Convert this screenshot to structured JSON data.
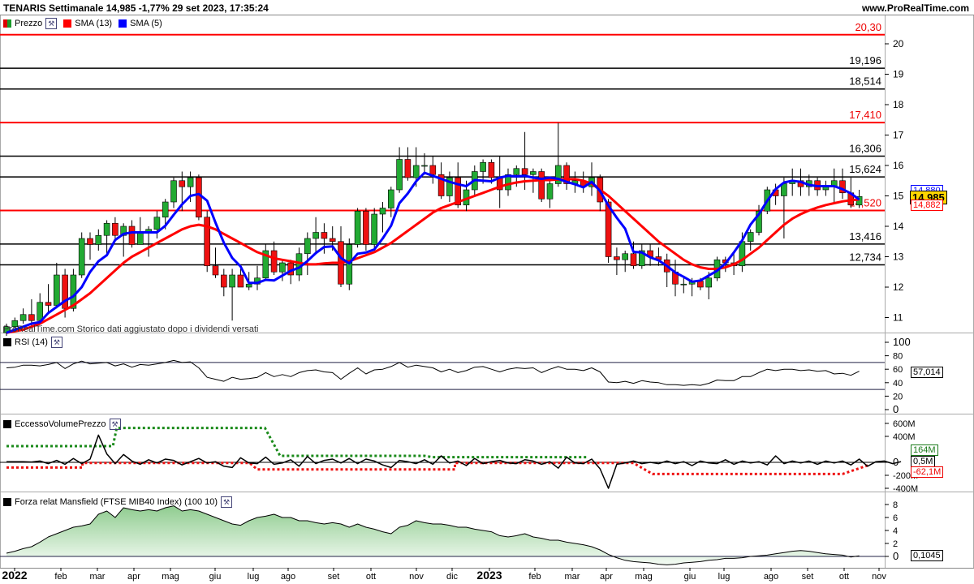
{
  "header": {
    "title": "TENARIS Settimanale 14,985 -1,77% 29 set 2023, 17:35:24",
    "site": "www.ProRealTime.com"
  },
  "price_panel": {
    "legend": [
      {
        "label": "Prezzo",
        "color": "#1a9a2a"
      },
      {
        "label": "SMA (13)",
        "color": "#ff0000"
      },
      {
        "label": "SMA (5)",
        "color": "#0000ff"
      }
    ],
    "watermark": "ProRealTime.com Storico dati aggiustato dopo i dividendi versati",
    "last_price": "14,985",
    "sma5_last": "14,880",
    "sma13_last": "14,882",
    "y_ticks": [
      "20",
      "19",
      "18",
      "17",
      "16",
      "15",
      "14",
      "13",
      "12",
      "11"
    ],
    "levels": [
      {
        "value": 20.3,
        "label": "20,30",
        "color": "#ff0000"
      },
      {
        "value": 19.196,
        "label": "19,196",
        "color": "#000000"
      },
      {
        "value": 18.514,
        "label": "18,514",
        "color": "#000000"
      },
      {
        "value": 17.41,
        "label": "17,410",
        "color": "#ff0000"
      },
      {
        "value": 16.306,
        "label": "16,306",
        "color": "#000000"
      },
      {
        "value": 15.624,
        "label": "15,624",
        "color": "#000000"
      },
      {
        "value": 14.52,
        "label": "14,520",
        "color": "#ff0000"
      },
      {
        "value": 13.416,
        "label": "13,416",
        "color": "#000000"
      },
      {
        "value": 12.734,
        "label": "12,734",
        "color": "#000000"
      }
    ]
  },
  "rsi_panel": {
    "title": "RSI (14)",
    "y_ticks": [
      "100",
      "80",
      "60",
      "40",
      "20",
      "0"
    ],
    "last": "57,014"
  },
  "volume_panel": {
    "title": "EccessoVolumePrezzo",
    "y_ticks": [
      "600M",
      "400M",
      "0",
      "-200M",
      "-400M"
    ],
    "upper_label": "164M",
    "mid_label": "0,5M",
    "lower_label": "-62,1M"
  },
  "mansfield_panel": {
    "title": "Forza relat Mansfield (FTSE MIB40 Index) (100 10)",
    "y_ticks": [
      "8",
      "6",
      "4",
      "2",
      "0"
    ],
    "last": "0,1045"
  },
  "x_axis": {
    "labels": [
      "2022",
      "feb",
      "mar",
      "apr",
      "mag",
      "giu",
      "lug",
      "ago",
      "set",
      "ott",
      "nov",
      "dic",
      "2023",
      "feb",
      "mar",
      "apr",
      "mag",
      "giu",
      "lug",
      "ago",
      "set",
      "ott",
      "nov"
    ]
  },
  "colors": {
    "up": "#22aa33",
    "down": "#ee1111",
    "sma13": "#ff0000",
    "sma5": "#0000ff",
    "volume_upper": "#1a8a1a",
    "volume_lower": "#ee1111",
    "mansfield_pos": "#b8dcb8",
    "mansfield_neg": "#e8b8c8"
  },
  "chart_data": {
    "type": "candlestick",
    "title": "TENARIS Settimanale",
    "ylim": [
      10.5,
      20.8
    ],
    "candles": [
      {
        "o": 10.5,
        "h": 10.8,
        "l": 10.4,
        "c": 10.7
      },
      {
        "o": 10.7,
        "h": 11.0,
        "l": 10.6,
        "c": 10.9
      },
      {
        "o": 10.9,
        "h": 11.3,
        "l": 10.8,
        "c": 11.1
      },
      {
        "o": 11.1,
        "h": 11.6,
        "l": 10.7,
        "c": 10.9
      },
      {
        "o": 10.9,
        "h": 11.8,
        "l": 10.8,
        "c": 11.5
      },
      {
        "o": 11.5,
        "h": 12.1,
        "l": 11.2,
        "c": 11.4
      },
      {
        "o": 11.4,
        "h": 12.8,
        "l": 11.3,
        "c": 12.4
      },
      {
        "o": 12.4,
        "h": 12.6,
        "l": 11.0,
        "c": 11.3
      },
      {
        "o": 11.3,
        "h": 12.6,
        "l": 11.2,
        "c": 12.4
      },
      {
        "o": 12.4,
        "h": 13.8,
        "l": 12.3,
        "c": 13.6
      },
      {
        "o": 13.6,
        "h": 13.8,
        "l": 12.9,
        "c": 13.4
      },
      {
        "o": 13.4,
        "h": 13.9,
        "l": 13.2,
        "c": 13.7
      },
      {
        "o": 13.7,
        "h": 14.2,
        "l": 13.1,
        "c": 14.1
      },
      {
        "o": 14.1,
        "h": 14.3,
        "l": 13.5,
        "c": 13.7
      },
      {
        "o": 13.7,
        "h": 14.1,
        "l": 13.0,
        "c": 14.0
      },
      {
        "o": 14.0,
        "h": 14.2,
        "l": 13.3,
        "c": 13.4
      },
      {
        "o": 13.4,
        "h": 14.3,
        "l": 13.4,
        "c": 13.8
      },
      {
        "o": 13.8,
        "h": 14.0,
        "l": 13.0,
        "c": 13.9
      },
      {
        "o": 13.9,
        "h": 14.5,
        "l": 13.6,
        "c": 14.3
      },
      {
        "o": 14.3,
        "h": 14.9,
        "l": 13.9,
        "c": 14.8
      },
      {
        "o": 14.8,
        "h": 15.6,
        "l": 14.6,
        "c": 15.5
      },
      {
        "o": 15.5,
        "h": 15.8,
        "l": 14.5,
        "c": 15.3
      },
      {
        "o": 15.3,
        "h": 15.8,
        "l": 14.8,
        "c": 15.6
      },
      {
        "o": 15.6,
        "h": 15.7,
        "l": 14.2,
        "c": 14.3
      },
      {
        "o": 14.3,
        "h": 14.5,
        "l": 12.5,
        "c": 12.7
      },
      {
        "o": 12.7,
        "h": 13.3,
        "l": 12.3,
        "c": 12.4
      },
      {
        "o": 12.4,
        "h": 12.6,
        "l": 11.7,
        "c": 12.0
      },
      {
        "o": 12.0,
        "h": 12.6,
        "l": 10.9,
        "c": 12.4
      },
      {
        "o": 12.4,
        "h": 12.6,
        "l": 12.0,
        "c": 12.0
      },
      {
        "o": 12.0,
        "h": 12.5,
        "l": 11.9,
        "c": 12.1
      },
      {
        "o": 12.1,
        "h": 12.7,
        "l": 11.9,
        "c": 12.3
      },
      {
        "o": 12.3,
        "h": 13.4,
        "l": 12.2,
        "c": 13.2
      },
      {
        "o": 13.2,
        "h": 13.5,
        "l": 12.4,
        "c": 12.5
      },
      {
        "o": 12.5,
        "h": 12.9,
        "l": 12.2,
        "c": 12.8
      },
      {
        "o": 12.8,
        "h": 12.9,
        "l": 12.1,
        "c": 12.4
      },
      {
        "o": 12.4,
        "h": 13.3,
        "l": 12.2,
        "c": 13.1
      },
      {
        "o": 13.1,
        "h": 13.8,
        "l": 12.4,
        "c": 13.6
      },
      {
        "o": 13.6,
        "h": 14.3,
        "l": 13.1,
        "c": 13.8
      },
      {
        "o": 13.8,
        "h": 14.1,
        "l": 13.1,
        "c": 13.6
      },
      {
        "o": 13.6,
        "h": 14.0,
        "l": 13.2,
        "c": 13.5
      },
      {
        "o": 13.5,
        "h": 14.0,
        "l": 12.0,
        "c": 12.1
      },
      {
        "o": 12.1,
        "h": 13.6,
        "l": 11.9,
        "c": 13.4
      },
      {
        "o": 13.4,
        "h": 14.6,
        "l": 13.3,
        "c": 14.5
      },
      {
        "o": 14.5,
        "h": 14.6,
        "l": 13.2,
        "c": 13.4
      },
      {
        "o": 13.4,
        "h": 14.6,
        "l": 13.2,
        "c": 14.4
      },
      {
        "o": 14.4,
        "h": 14.8,
        "l": 13.8,
        "c": 14.6
      },
      {
        "o": 14.6,
        "h": 15.3,
        "l": 14.3,
        "c": 15.2
      },
      {
        "o": 15.2,
        "h": 16.6,
        "l": 15.1,
        "c": 16.2
      },
      {
        "o": 16.2,
        "h": 16.6,
        "l": 15.5,
        "c": 15.6
      },
      {
        "o": 15.6,
        "h": 16.6,
        "l": 15.3,
        "c": 16.0
      },
      {
        "o": 16.0,
        "h": 16.4,
        "l": 15.7,
        "c": 16.0
      },
      {
        "o": 16.0,
        "h": 16.3,
        "l": 15.4,
        "c": 15.7
      },
      {
        "o": 15.7,
        "h": 16.1,
        "l": 14.9,
        "c": 15.0
      },
      {
        "o": 15.0,
        "h": 15.8,
        "l": 14.8,
        "c": 15.6
      },
      {
        "o": 15.6,
        "h": 16.1,
        "l": 14.6,
        "c": 14.7
      },
      {
        "o": 14.7,
        "h": 15.5,
        "l": 14.5,
        "c": 15.2
      },
      {
        "o": 15.2,
        "h": 16.0,
        "l": 15.0,
        "c": 15.8
      },
      {
        "o": 15.8,
        "h": 16.2,
        "l": 15.4,
        "c": 16.1
      },
      {
        "o": 16.1,
        "h": 16.2,
        "l": 15.4,
        "c": 15.6
      },
      {
        "o": 15.6,
        "h": 16.3,
        "l": 14.6,
        "c": 15.2
      },
      {
        "o": 15.2,
        "h": 15.9,
        "l": 15.0,
        "c": 15.7
      },
      {
        "o": 15.7,
        "h": 16.0,
        "l": 15.3,
        "c": 15.9
      },
      {
        "o": 15.9,
        "h": 17.1,
        "l": 15.2,
        "c": 15.7
      },
      {
        "o": 15.7,
        "h": 15.9,
        "l": 15.1,
        "c": 15.8
      },
      {
        "o": 15.8,
        "h": 15.9,
        "l": 14.8,
        "c": 14.9
      },
      {
        "o": 14.9,
        "h": 15.6,
        "l": 14.6,
        "c": 15.4
      },
      {
        "o": 15.4,
        "h": 17.4,
        "l": 15.3,
        "c": 16.0
      },
      {
        "o": 16.0,
        "h": 16.1,
        "l": 15.2,
        "c": 15.4
      },
      {
        "o": 15.4,
        "h": 15.8,
        "l": 15.1,
        "c": 15.5
      },
      {
        "o": 15.5,
        "h": 15.8,
        "l": 15.1,
        "c": 15.3
      },
      {
        "o": 15.3,
        "h": 16.1,
        "l": 15.0,
        "c": 15.6
      },
      {
        "o": 15.6,
        "h": 15.7,
        "l": 14.5,
        "c": 14.8
      },
      {
        "o": 14.8,
        "h": 14.9,
        "l": 12.8,
        "c": 13.0
      },
      {
        "o": 13.0,
        "h": 13.3,
        "l": 12.4,
        "c": 12.9
      },
      {
        "o": 12.9,
        "h": 13.2,
        "l": 12.5,
        "c": 13.1
      },
      {
        "o": 13.1,
        "h": 13.5,
        "l": 12.6,
        "c": 12.7
      },
      {
        "o": 12.7,
        "h": 13.4,
        "l": 12.6,
        "c": 13.2
      },
      {
        "o": 13.2,
        "h": 13.4,
        "l": 12.7,
        "c": 13.0
      },
      {
        "o": 13.0,
        "h": 13.3,
        "l": 12.7,
        "c": 12.9
      },
      {
        "o": 12.9,
        "h": 13.1,
        "l": 12.0,
        "c": 12.5
      },
      {
        "o": 12.5,
        "h": 12.9,
        "l": 11.7,
        "c": 12.1
      },
      {
        "o": 12.1,
        "h": 12.3,
        "l": 11.8,
        "c": 12.1
      },
      {
        "o": 12.1,
        "h": 12.3,
        "l": 11.7,
        "c": 12.2
      },
      {
        "o": 12.2,
        "h": 12.3,
        "l": 11.9,
        "c": 12.0
      },
      {
        "o": 12.0,
        "h": 12.5,
        "l": 11.6,
        "c": 12.3
      },
      {
        "o": 12.3,
        "h": 13.0,
        "l": 12.2,
        "c": 12.9
      },
      {
        "o": 12.9,
        "h": 13.0,
        "l": 12.5,
        "c": 12.8
      },
      {
        "o": 12.8,
        "h": 13.1,
        "l": 12.4,
        "c": 12.7
      },
      {
        "o": 12.7,
        "h": 13.8,
        "l": 12.5,
        "c": 13.5
      },
      {
        "o": 13.5,
        "h": 13.9,
        "l": 13.2,
        "c": 13.8
      },
      {
        "o": 13.8,
        "h": 14.7,
        "l": 13.7,
        "c": 14.5
      },
      {
        "o": 14.5,
        "h": 15.3,
        "l": 14.4,
        "c": 15.2
      },
      {
        "o": 15.2,
        "h": 15.4,
        "l": 14.7,
        "c": 15.0
      },
      {
        "o": 15.0,
        "h": 15.6,
        "l": 13.6,
        "c": 15.4
      },
      {
        "o": 15.4,
        "h": 15.9,
        "l": 15.0,
        "c": 15.5
      },
      {
        "o": 15.5,
        "h": 15.9,
        "l": 15.0,
        "c": 15.3
      },
      {
        "o": 15.3,
        "h": 15.7,
        "l": 15.0,
        "c": 15.5
      },
      {
        "o": 15.5,
        "h": 15.6,
        "l": 15.0,
        "c": 15.2
      },
      {
        "o": 15.2,
        "h": 15.5,
        "l": 15.0,
        "c": 15.3
      },
      {
        "o": 15.3,
        "h": 15.9,
        "l": 14.8,
        "c": 15.5
      },
      {
        "o": 15.5,
        "h": 15.9,
        "l": 14.9,
        "c": 15.1
      },
      {
        "o": 15.1,
        "h": 15.6,
        "l": 14.6,
        "c": 14.7
      },
      {
        "o": 14.7,
        "h": 15.2,
        "l": 14.6,
        "c": 14.98
      }
    ],
    "sma5": [
      10.5,
      10.6,
      10.7,
      10.8,
      10.85,
      11.15,
      11.35,
      11.55,
      11.7,
      12.0,
      12.5,
      12.85,
      13.05,
      13.55,
      13.75,
      13.8,
      13.8,
      13.8,
      13.8,
      14.02,
      14.38,
      14.72,
      15.0,
      15.06,
      14.84,
      14.12,
      13.46,
      12.96,
      12.68,
      12.14,
      12.14,
      12.24,
      12.22,
      12.38,
      12.54,
      12.64,
      12.86,
      13.12,
      13.32,
      13.34,
      12.96,
      12.78,
      13.1,
      13.14,
      13.24,
      13.6,
      14.02,
      14.76,
      15.08,
      15.48,
      15.76,
      15.66,
      15.56,
      15.46,
      15.38,
      15.32,
      15.52,
      15.5,
      15.48,
      15.6,
      15.66,
      15.64,
      15.66,
      15.6,
      15.56,
      15.6,
      15.56,
      15.46,
      15.38,
      15.28,
      15.46,
      15.16,
      14.68,
      14.28,
      13.92,
      13.16,
      13.14,
      12.98,
      12.88,
      12.7,
      12.48,
      12.34,
      12.18,
      12.22,
      12.38,
      12.54,
      12.78,
      13.14,
      13.54,
      14.06,
      14.4,
      14.84,
      15.22,
      15.44,
      15.5,
      15.46,
      15.36,
      15.32,
      15.32,
      15.32,
      15.22,
      15.08,
      14.88
    ],
    "sma13": [
      10.5,
      10.55,
      10.6,
      10.7,
      10.8,
      10.95,
      11.1,
      11.25,
      11.4,
      11.6,
      11.8,
      12.05,
      12.3,
      12.55,
      12.8,
      13.0,
      13.15,
      13.3,
      13.45,
      13.6,
      13.75,
      13.9,
      14.0,
      14.05,
      14.0,
      13.9,
      13.75,
      13.6,
      13.45,
      13.3,
      13.15,
      13.05,
      12.95,
      12.9,
      12.85,
      12.8,
      12.75,
      12.75,
      12.78,
      12.8,
      12.8,
      12.85,
      12.95,
      13.05,
      13.15,
      13.3,
      13.45,
      13.65,
      13.85,
      14.05,
      14.25,
      14.45,
      14.6,
      14.7,
      14.8,
      14.9,
      15.0,
      15.1,
      15.2,
      15.3,
      15.38,
      15.44,
      15.48,
      15.5,
      15.52,
      15.52,
      15.54,
      15.55,
      15.55,
      15.5,
      15.4,
      15.2,
      15.0,
      14.75,
      14.5,
      14.25,
      14.0,
      13.75,
      13.5,
      13.3,
      13.1,
      12.9,
      12.75,
      12.65,
      12.6,
      12.6,
      12.65,
      12.75,
      12.9,
      13.1,
      13.3,
      13.55,
      13.8,
      14.05,
      14.25,
      14.4,
      14.52,
      14.62,
      14.7,
      14.76,
      14.82,
      14.86,
      14.88
    ],
    "rsi": [
      62,
      63,
      66,
      66,
      65,
      67,
      70,
      61,
      68,
      72,
      68,
      69,
      70,
      65,
      68,
      63,
      67,
      66,
      68,
      70,
      73,
      70,
      71,
      62,
      48,
      45,
      42,
      48,
      45,
      46,
      48,
      55,
      49,
      52,
      49,
      55,
      58,
      59,
      56,
      55,
      45,
      54,
      62,
      53,
      59,
      60,
      64,
      70,
      63,
      66,
      64,
      62,
      56,
      60,
      55,
      58,
      63,
      64,
      60,
      56,
      60,
      62,
      61,
      62,
      55,
      60,
      64,
      60,
      60,
      58,
      62,
      56,
      41,
      40,
      42,
      39,
      43,
      41,
      40,
      37,
      37,
      36,
      37,
      36,
      39,
      44,
      43,
      43,
      49,
      49,
      55,
      60,
      58,
      60,
      60,
      58,
      59,
      57,
      58,
      53,
      54,
      51,
      57
    ],
    "volume_excess": [
      10,
      10,
      10,
      5,
      20,
      -20,
      30,
      -30,
      60,
      -20,
      50,
      420,
      130,
      -20,
      120,
      20,
      -30,
      40,
      -10,
      50,
      30,
      -40,
      10,
      60,
      -10,
      10,
      -60,
      -80,
      70,
      -10,
      -20,
      80,
      -30,
      -10,
      40,
      -60,
      90,
      -20,
      30,
      50,
      -10,
      60,
      -20,
      50,
      20,
      -40,
      -80,
      30,
      10,
      -20,
      40,
      -30,
      100,
      -10,
      20,
      -50,
      60,
      -20,
      10,
      30,
      -10,
      -20,
      40,
      20,
      -30,
      10,
      -90,
      80,
      -10,
      -20,
      50,
      -100,
      -400,
      -30,
      -10,
      20,
      -20,
      0,
      -20,
      20,
      -20,
      10,
      -50,
      20,
      -10,
      -20,
      40,
      -30,
      20,
      -10,
      10,
      -40,
      100,
      -20,
      20,
      -10,
      20,
      -30,
      20,
      -10,
      20,
      -40,
      50,
      -60,
      10,
      20,
      -20,
      10
    ],
    "mansfield": [
      0.5,
      0.8,
      1.2,
      1.5,
      2.2,
      3.0,
      3.5,
      4.0,
      4.5,
      4.7,
      5.0,
      6.5,
      7.0,
      6.0,
      7.5,
      7.2,
      7.0,
      7.2,
      7.0,
      7.5,
      7.8,
      7.0,
      7.2,
      7.0,
      6.5,
      6.0,
      5.5,
      5.0,
      4.8,
      5.5,
      6.0,
      6.2,
      6.5,
      6.0,
      6.0,
      5.5,
      5.5,
      5.2,
      5.0,
      5.2,
      5.0,
      4.5,
      5.0,
      4.5,
      4.2,
      3.8,
      3.5,
      4.5,
      4.8,
      5.5,
      5.2,
      5.0,
      5.0,
      4.8,
      4.5,
      4.5,
      4.2,
      4.0,
      3.8,
      3.2,
      3.0,
      3.2,
      3.5,
      3.0,
      2.8,
      2.5,
      2.5,
      2.2,
      2.0,
      1.8,
      1.5,
      1.0,
      0.3,
      -0.2,
      -0.6,
      -0.8,
      -0.9,
      -1.0,
      -1.2,
      -1.3,
      -1.2,
      -1.0,
      -0.9,
      -0.8,
      -0.6,
      -0.5,
      -0.3,
      -0.3,
      -0.2,
      0.0,
      0.1,
      0.2,
      0.4,
      0.6,
      0.8,
      0.9,
      0.8,
      0.6,
      0.4,
      0.3,
      0.2,
      -0.1,
      0.1
    ],
    "volume_upper_band": [
      [
        0,
        250
      ],
      [
        28,
        250
      ],
      [
        29,
        530
      ],
      [
        68,
        530
      ],
      [
        72,
        100
      ],
      [
        100,
        100
      ],
      [
        110,
        100
      ],
      [
        112,
        80
      ],
      [
        153,
        80
      ]
    ],
    "volume_lower_band": [
      [
        0,
        -80
      ],
      [
        20,
        -80
      ],
      [
        20,
        -10
      ],
      [
        64,
        -10
      ],
      [
        66,
        -110
      ],
      [
        118,
        -110
      ],
      [
        118,
        -10
      ],
      [
        165,
        -10
      ],
      [
        170,
        -180
      ],
      [
        220,
        -180
      ],
      [
        227,
        -40
      ]
    ]
  }
}
